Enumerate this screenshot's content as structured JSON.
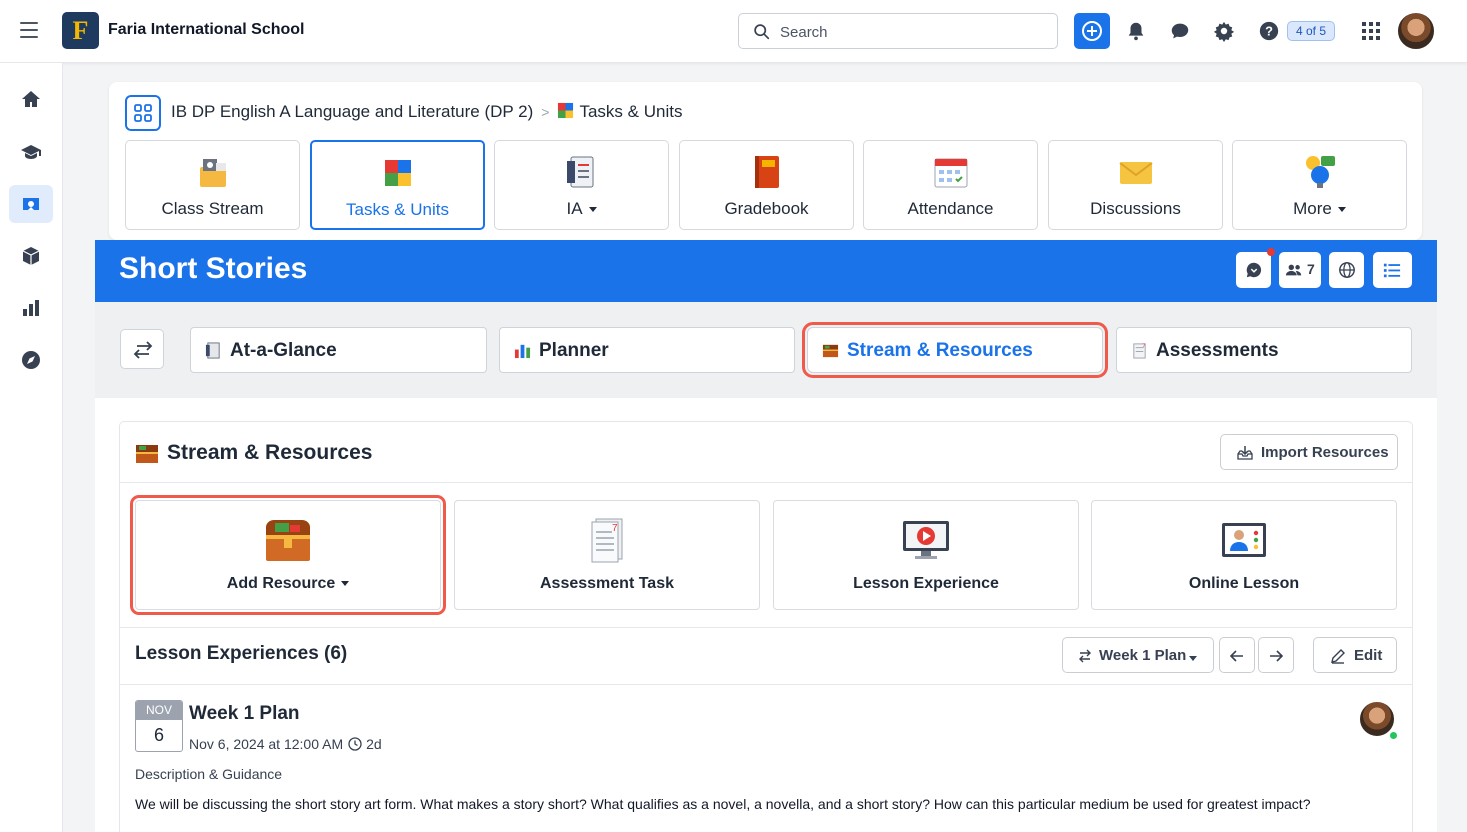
{
  "topbar": {
    "school_name": "Faria International School",
    "search_placeholder": "Search",
    "help_badge": "4 of 5"
  },
  "course": {
    "breadcrumb_course": "IB DP English A Language and Literature (DP 2)",
    "breadcrumb_page": "Tasks & Units",
    "tabs": [
      {
        "label": "Class Stream"
      },
      {
        "label": "Tasks & Units",
        "active": true
      },
      {
        "label": "IA"
      },
      {
        "label": "Gradebook"
      },
      {
        "label": "Attendance"
      },
      {
        "label": "Discussions"
      },
      {
        "label": "More"
      }
    ]
  },
  "unit": {
    "title": "Short Stories",
    "members_count": "7",
    "tabs": [
      {
        "label": "At-a-Glance"
      },
      {
        "label": "Planner"
      },
      {
        "label": "Stream & Resources",
        "active": true
      },
      {
        "label": "Assessments"
      }
    ]
  },
  "resources": {
    "title": "Stream & Resources",
    "import_label": "Import Resources",
    "tiles": [
      {
        "label": "Add Resource"
      },
      {
        "label": "Assessment Task"
      },
      {
        "label": "Lesson Experience"
      },
      {
        "label": "Online Lesson"
      }
    ]
  },
  "lessons": {
    "heading": "Lesson Experiences (6)",
    "plan_select": "Week 1 Plan",
    "edit_label": "Edit",
    "item": {
      "month": "NOV",
      "day": "6",
      "title": "Week 1 Plan",
      "datetime": "Nov 6, 2024 at 12:00 AM",
      "duration": "2d",
      "desc_label": "Description & Guidance",
      "description": "We will be discussing the short story art form. What makes a story short? What qualifies as a novel, a novella, and a short story? How can this particular medium be used for greatest impact?"
    }
  },
  "colors": {
    "primary": "#1a73e8",
    "highlight": "#ef5a4a",
    "online": "#22c55e"
  }
}
